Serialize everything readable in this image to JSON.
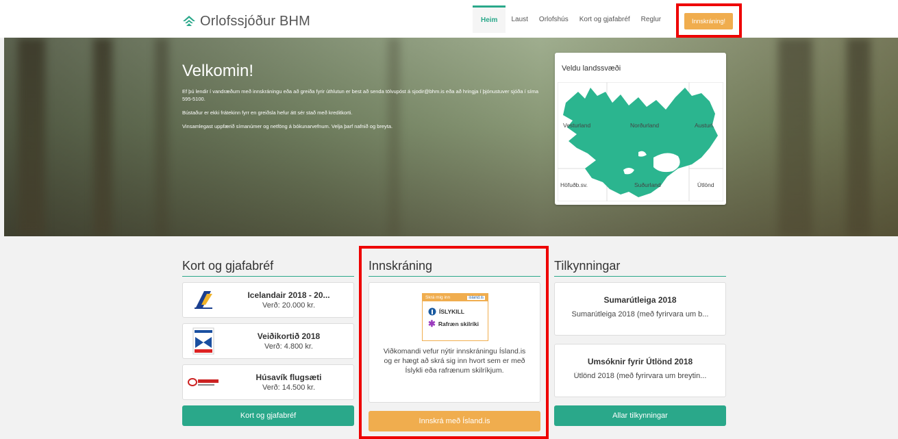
{
  "header": {
    "logo_text": "Orlofssjóður BHM",
    "nav": [
      "Heim",
      "Laust",
      "Orlofshús",
      "Kort og gjafabréf",
      "Reglur"
    ],
    "login_label": "Innskráning!"
  },
  "hero": {
    "title": "Velkomin!",
    "lines": [
      "Ef þú lendir í vandræðum með innskráningu eða að greiða fyrir úthlutun er best að senda tölvupóst á sjodir@bhm.is eða að hringja í þjónustuver sjóða í síma 595-5100.",
      "Bústaður er ekki frátekinn fyrr en greiðsla hefur átt sér stað með kreditkorti.",
      "Vinsamlegast uppfærið símanúmer og netföng á bókunarvefnum. Velja þarf nafnið og breyta."
    ]
  },
  "map": {
    "title": "Veldu landssvæði",
    "regions": [
      "Vesturland",
      "Norðurland",
      "Austurl.",
      "Höfuðb.sv.",
      "Suðurland",
      "Útlönd"
    ]
  },
  "gift": {
    "heading": "Kort og gjafabréf",
    "items": [
      {
        "title": "Icelandair 2018 - 20...",
        "price": "Verð: 20.000 kr."
      },
      {
        "title": "Veiðikortið 2018",
        "price": "Verð: 4.800 kr."
      },
      {
        "title": "Húsavík flugsæti",
        "price": "Verð: 14.500 kr."
      }
    ],
    "button": "Kort og gjafabréf"
  },
  "login": {
    "heading": "Innskráning",
    "logo_top": "Skrá mig inn",
    "logo_brand": "island.is",
    "logo_row1": "ÍSLYKILL",
    "logo_row2": "Rafræn skilríki",
    "text": "Viðkomandi vefur nýtir innskráningu Ísland.is og er hægt að skrá sig inn hvort sem er með Íslykli eða rafrænum skilríkjum.",
    "button": "Innskrá með Ísland.is"
  },
  "news": {
    "heading": "Tilkynningar",
    "items": [
      {
        "title": "Sumarútleiga 2018",
        "sub": "Sumarútleiga 2018 (með fyrirvara um b..."
      },
      {
        "title": "Umsóknir fyrir Útlönd 2018",
        "sub": "Útlönd 2018 (með fyrirvara um breytin..."
      }
    ],
    "button": "Allar tilkynningar"
  },
  "colors": {
    "accent": "#2aa88a",
    "orange": "#f0ad4e",
    "highlight": "#e00000"
  }
}
